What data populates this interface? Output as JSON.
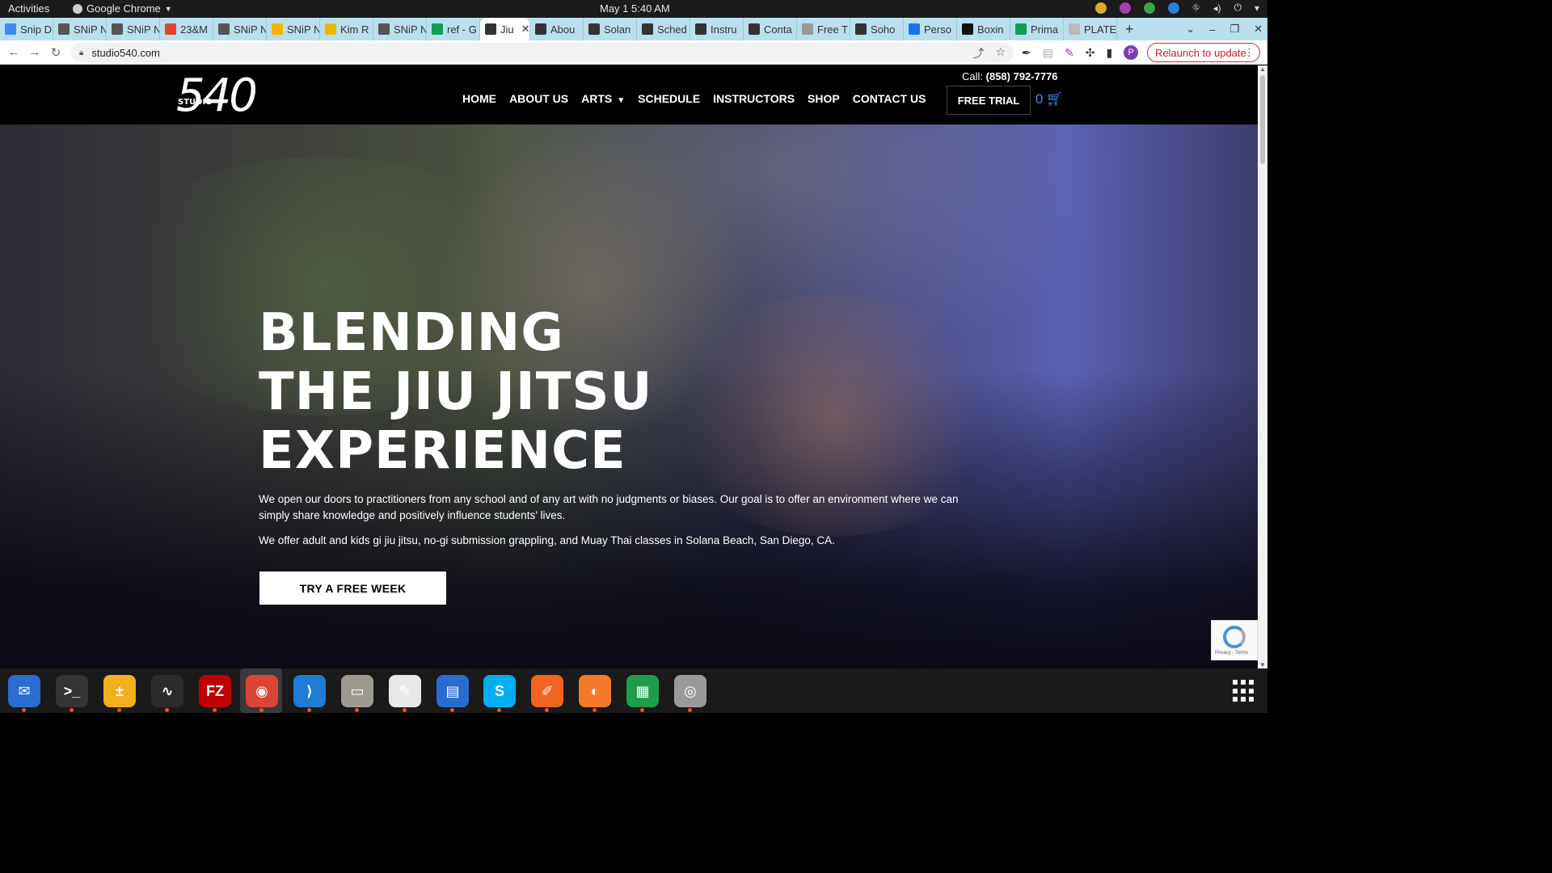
{
  "system": {
    "activities": "Activities",
    "app_name": "Google Chrome",
    "clock": "May 1  5:40 AM"
  },
  "tabs": [
    {
      "label": "Snip D",
      "icon_color": "#4285f4"
    },
    {
      "label": "SNiP N",
      "icon_color": "#555555"
    },
    {
      "label": "SNiP N",
      "icon_color": "#555555"
    },
    {
      "label": "23&M",
      "icon_color": "#e24329"
    },
    {
      "label": "SNiP N",
      "icon_color": "#555555"
    },
    {
      "label": "SNiP N",
      "icon_color": "#f4b400"
    },
    {
      "label": "Kim R",
      "icon_color": "#f4b400"
    },
    {
      "label": "SNiP N",
      "icon_color": "#555555"
    },
    {
      "label": "ref - G",
      "icon_color": "#0f9d58"
    },
    {
      "label": "Jiu",
      "icon_color": "#333333",
      "active": true
    },
    {
      "label": "Abou",
      "icon_color": "#333333"
    },
    {
      "label": "Solan",
      "icon_color": "#333333"
    },
    {
      "label": "Sched",
      "icon_color": "#333333"
    },
    {
      "label": "Instru",
      "icon_color": "#333333"
    },
    {
      "label": "Conta",
      "icon_color": "#333333"
    },
    {
      "label": "Free T",
      "icon_color": "#999999"
    },
    {
      "label": "Soho",
      "icon_color": "#333333"
    },
    {
      "label": "Perso",
      "icon_color": "#1a73e8"
    },
    {
      "label": "Boxin",
      "icon_color": "#111111"
    },
    {
      "label": "Prima",
      "icon_color": "#0f9d58"
    },
    {
      "label": "PLATE",
      "icon_color": "#bbbbbb"
    }
  ],
  "addressbar": {
    "url": "studio540.com",
    "relaunch": "Relaunch to update",
    "profile_initial": "P"
  },
  "site": {
    "logo_number": "540",
    "logo_studio": "STUDIO",
    "phone_label": "Call:",
    "phone_number": "(858) 792-7776",
    "nav": [
      "HOME",
      "ABOUT US",
      "ARTS",
      "SCHEDULE",
      "INSTRUCTORS",
      "SHOP",
      "CONTACT US"
    ],
    "free_trial": "FREE TRIAL",
    "cart_count": "0"
  },
  "hero": {
    "headline": [
      "BLENDING",
      "THE JIU JITSU",
      "EXPERIENCE"
    ],
    "paragraph1": "We open our doors to practitioners from any school and of any art with no judgments or biases. Our goal is to offer an environment where we can simply share knowledge and positively influence students’ lives.",
    "paragraph2": "We offer adult and kids gi jiu jitsu, no-gi submission grappling, and Muay Thai classes in Solana Beach, San Diego, CA.",
    "cta": "TRY A FREE WEEK"
  },
  "recaptcha": {
    "text": "Privacy - Terms"
  },
  "dock": [
    {
      "name": "thunderbird-icon",
      "color": "#2a6ccf",
      "glyph": "✉"
    },
    {
      "name": "terminal-icon",
      "color": "#333333",
      "glyph": ">_"
    },
    {
      "name": "calculator-icon",
      "color": "#f2b01e",
      "glyph": "±"
    },
    {
      "name": "system-monitor-icon",
      "color": "#2b2b2b",
      "glyph": "∿"
    },
    {
      "name": "filezilla-icon",
      "color": "#bf0000",
      "glyph": "FZ"
    },
    {
      "name": "chrome-icon",
      "color": "#db4437",
      "glyph": "◉"
    },
    {
      "name": "vscode-icon",
      "color": "#1f7bd3",
      "glyph": "⟩"
    },
    {
      "name": "files-icon",
      "color": "#9e9a92",
      "glyph": "▭"
    },
    {
      "name": "text-editor-icon",
      "color": "#e8e8e8",
      "glyph": "✎"
    },
    {
      "name": "document-viewer-icon",
      "color": "#2a6ccf",
      "glyph": "▤"
    },
    {
      "name": "skype-icon",
      "color": "#00aff0",
      "glyph": "S"
    },
    {
      "name": "inkscape-icon",
      "color": "#f26322",
      "glyph": "✐"
    },
    {
      "name": "blender-icon",
      "color": "#f5792a",
      "glyph": "◐"
    },
    {
      "name": "spreadsheet-icon",
      "color": "#1e9e4a",
      "glyph": "▦"
    },
    {
      "name": "disk-icon",
      "color": "#9a9a9a",
      "glyph": "◎"
    }
  ]
}
